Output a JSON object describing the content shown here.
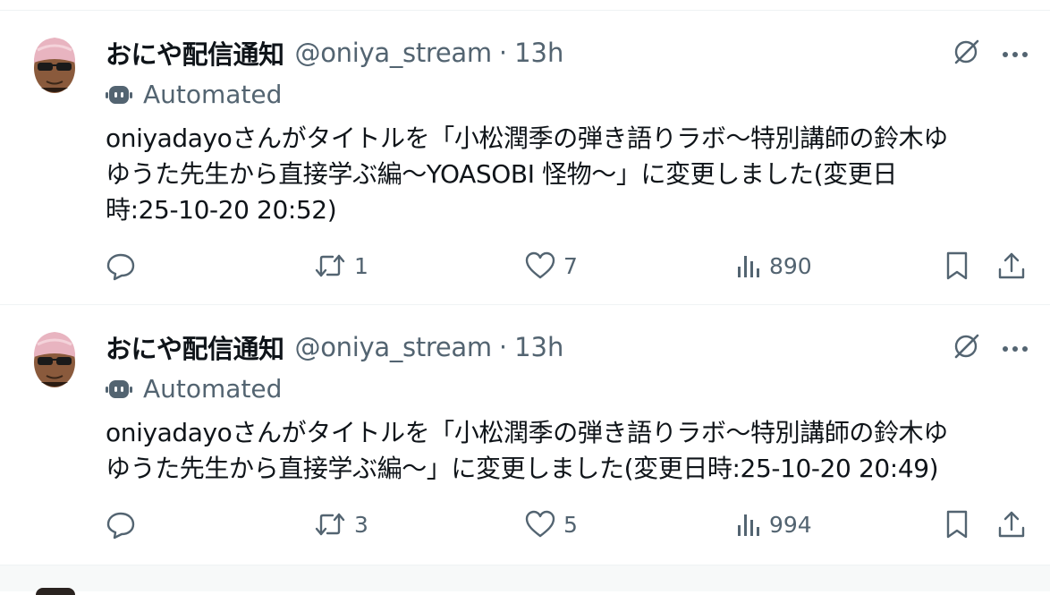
{
  "colors": {
    "text_primary": "#0f1419",
    "text_secondary": "#536471",
    "divider": "#eff3f4",
    "background": "#ffffff"
  },
  "tweets": [
    {
      "display_name": "おにや配信通知",
      "handle": "@oniya_stream",
      "separator": "·",
      "time": "13h",
      "automated_label": "Automated",
      "text_lines": [
        "oniyadayoさんがタイトルを「小松潤季の弾き語りラボ〜特別講師の鈴木ゆ",
        "ゆうた先生から直接学ぶ編〜YOASOBI 怪物〜」に変更しました(変更日",
        "時:25-10-20 20:52)"
      ],
      "replies": "",
      "retweets": "1",
      "likes": "7",
      "views": "890",
      "icons": [
        "avatar",
        "grok-icon",
        "more-icon",
        "bot-icon",
        "reply-icon",
        "retweet-icon",
        "like-icon",
        "views-icon",
        "bookmark-icon",
        "share-icon"
      ]
    },
    {
      "display_name": "おにや配信通知",
      "handle": "@oniya_stream",
      "separator": "·",
      "time": "13h",
      "automated_label": "Automated",
      "text_lines": [
        "oniyadayoさんがタイトルを「小松潤季の弾き語りラボ〜特別講師の鈴木ゆ",
        "ゆうた先生から直接学ぶ編〜」に変更しました(変更日時:25-10-20 20:49)"
      ],
      "replies": "",
      "retweets": "3",
      "likes": "5",
      "views": "994",
      "icons": [
        "avatar",
        "grok-icon",
        "more-icon",
        "bot-icon",
        "reply-icon",
        "retweet-icon",
        "like-icon",
        "views-icon",
        "bookmark-icon",
        "share-icon"
      ]
    }
  ]
}
